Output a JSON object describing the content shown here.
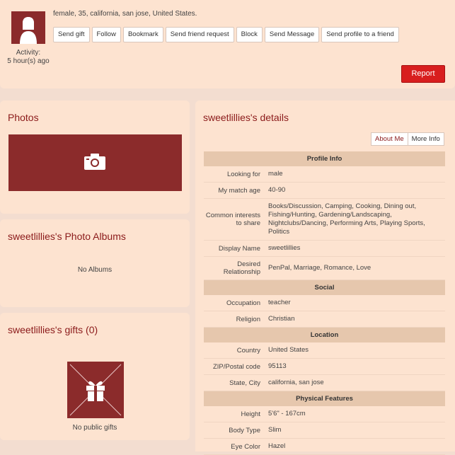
{
  "header": {
    "summary": "female, 35, california, san jose, United States.",
    "activity_label": "Activity:",
    "activity_value": "5 hour(s) ago",
    "actions": [
      "Send gift",
      "Follow",
      "Bookmark",
      "Send friend request",
      "Block",
      "Send Message",
      "Send profile to a friend"
    ],
    "report_label": "Report"
  },
  "photos": {
    "title": "Photos",
    "icon": "camera-icon"
  },
  "albums": {
    "title": "sweetlillies's Photo Albums",
    "empty": "No Albums"
  },
  "gifts": {
    "title": "sweetlillies's gifts (0)",
    "empty": "No public gifts",
    "icon": "gift-icon"
  },
  "details": {
    "title": "sweetlillies's details",
    "tabs": [
      "About Me",
      "More Info"
    ],
    "sections": [
      {
        "title": "Profile Info",
        "rows": [
          {
            "label": "Looking for",
            "value": "male"
          },
          {
            "label": "My match age",
            "value": "40-90"
          },
          {
            "label": "Common interests to share",
            "value": "Books/Discussion, Camping, Cooking, Dining out, Fishing/Hunting, Gardening/Landscaping, Nightclubs/Dancing, Performing Arts, Playing Sports, Politics"
          },
          {
            "label": "Display Name",
            "value": "sweetlillies"
          },
          {
            "label": "Desired Relationship",
            "value": "PenPal, Marriage, Romance, Love"
          }
        ]
      },
      {
        "title": "Social",
        "rows": [
          {
            "label": "Occupation",
            "value": "teacher"
          },
          {
            "label": "Religion",
            "value": "Christian"
          }
        ]
      },
      {
        "title": "Location",
        "rows": [
          {
            "label": "Country",
            "value": "United States"
          },
          {
            "label": "ZIP/Postal code",
            "value": "95113"
          },
          {
            "label": "State, City",
            "value": "california, san jose"
          }
        ]
      },
      {
        "title": "Physical Features",
        "rows": [
          {
            "label": "Height",
            "value": "5'6\" - 167cm"
          },
          {
            "label": "Body Type",
            "value": "Slim"
          },
          {
            "label": "Eye Color",
            "value": "Hazel"
          }
        ]
      }
    ]
  },
  "colors": {
    "accent": "#8b2b2b",
    "report": "#d81e1e",
    "section_bg": "#e6c7ad",
    "card_bg": "#fde3d0"
  }
}
